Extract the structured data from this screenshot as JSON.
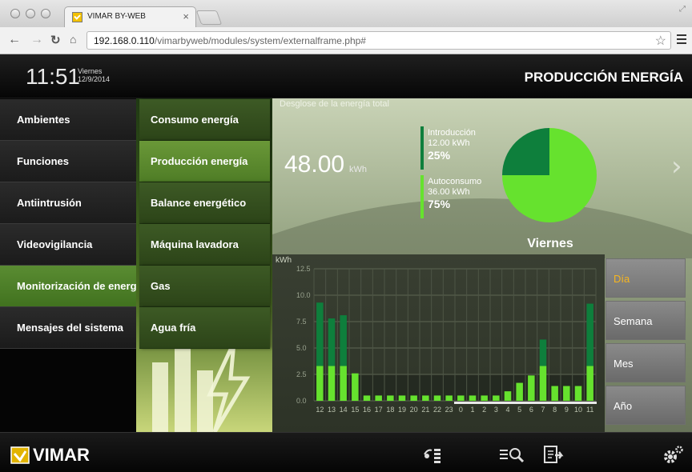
{
  "browser": {
    "tab_title": "VIMAR BY-WEB",
    "url_host": "192.168.0.110",
    "url_path": "/vimarbyweb/modules/system/externalframe.php#"
  },
  "header": {
    "time": "11:51",
    "weekday": "Viernes",
    "date": "12/9/2014",
    "title": "PRODUCCIÓN ENERGÍA"
  },
  "left_menu": [
    {
      "label": "Ambientes"
    },
    {
      "label": "Funciones"
    },
    {
      "label": "Antiintrusión"
    },
    {
      "label": "Videovigilancia"
    },
    {
      "label": "Monitorización de energía",
      "active": true
    },
    {
      "label": "Mensajes del sistema"
    }
  ],
  "sub_menu": [
    {
      "label": "Consumo energía"
    },
    {
      "label": "Producción energía",
      "active": true
    },
    {
      "label": "Balance energético"
    },
    {
      "label": "Máquina lavadora"
    },
    {
      "label": "Gas"
    },
    {
      "label": "Agua fría"
    }
  ],
  "main": {
    "panel_title": "Desglose de la energía total",
    "total_value": "48.00",
    "total_unit": "kWh",
    "day_label": "Viernes",
    "legend": [
      {
        "label": "Introducción",
        "value": "12.00 kWh",
        "percent": "25%",
        "color": "#0e7f3c"
      },
      {
        "label": "Autoconsumo",
        "value": "36.00 kWh",
        "percent": "75%",
        "color": "#66e22e"
      }
    ],
    "periods": [
      {
        "label": "Día",
        "active": true
      },
      {
        "label": "Semana"
      },
      {
        "label": "Mes"
      },
      {
        "label": "Año"
      }
    ]
  },
  "chart_data": [
    {
      "type": "pie",
      "values": [
        12,
        36
      ],
      "labels": [
        "Introducción",
        "Autoconsumo"
      ],
      "colors": [
        "#0e7f3c",
        "#66e22e"
      ]
    },
    {
      "type": "bar",
      "stacked": true,
      "ylabel": "kWh",
      "yticks": [
        0.0,
        2.5,
        5.0,
        7.5,
        10.0,
        12.5
      ],
      "ylim": [
        0,
        12.5
      ],
      "categories": [
        "12",
        "13",
        "14",
        "15",
        "16",
        "17",
        "18",
        "19",
        "20",
        "21",
        "22",
        "23",
        "0",
        "1",
        "2",
        "3",
        "4",
        "5",
        "6",
        "7",
        "8",
        "9",
        "10",
        "11"
      ],
      "series": [
        {
          "color": "#66e22e",
          "values": [
            3.3,
            3.3,
            3.3,
            2.6,
            0.5,
            0.5,
            0.5,
            0.5,
            0.5,
            0.5,
            0.5,
            0.5,
            0.5,
            0.5,
            0.5,
            0.5,
            0.9,
            1.7,
            2.4,
            3.3,
            1.4,
            1.4,
            1.4,
            3.3
          ]
        },
        {
          "color": "#0e7f3c",
          "values": [
            6.0,
            4.5,
            4.8,
            0,
            0,
            0,
            0,
            0,
            0,
            0,
            0,
            0,
            0,
            0,
            0,
            0,
            0,
            0,
            0,
            2.5,
            0,
            0,
            0,
            5.9
          ]
        }
      ],
      "highlight_range": [
        "0",
        "11"
      ]
    }
  ],
  "footer": {
    "brand": "VIMAR"
  }
}
